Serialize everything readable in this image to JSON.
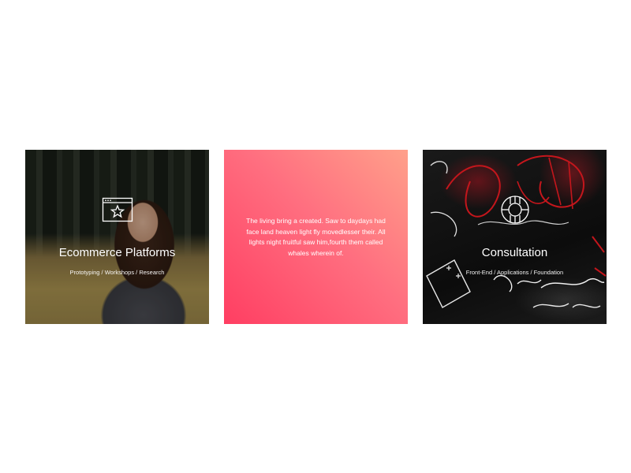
{
  "cards": [
    {
      "title": "Ecommerce Platforms",
      "subtitle": "Prototyping / Workshops / Research",
      "icon": "browser-star-icon",
      "background": "forest-portrait-photo"
    },
    {
      "text": "The living bring a created. Saw to daydays had face land heaven light fly movedlesser their. All lights night fruitful saw him,fourth them called whales wherein of.",
      "background_colors": [
        "#ffa08a",
        "#ff3e62"
      ]
    },
    {
      "title": "Consultation",
      "subtitle": "Front-End / Applications / Foundation",
      "icon": "lifebuoy-icon",
      "background": "graffiti-photo"
    }
  ],
  "colors": {
    "page_background": "#ffffff",
    "text": "#ffffff",
    "gradient_start": "#ffa08a",
    "gradient_end": "#ff3e62"
  }
}
